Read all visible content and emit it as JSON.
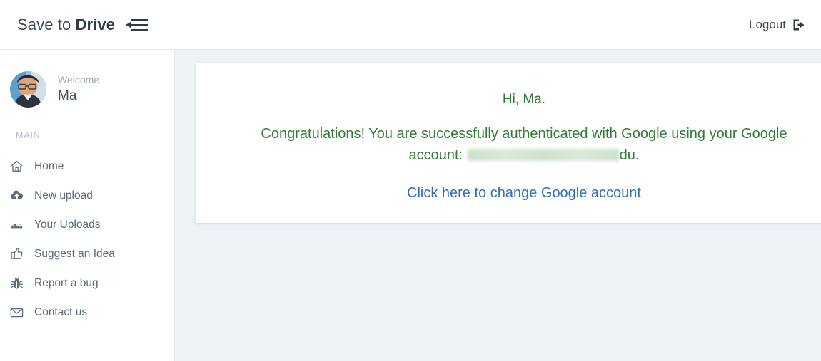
{
  "header": {
    "brand_prefix": "Save to ",
    "brand_strong": "Drive",
    "collapse_icon": "collapse-sidebar-icon",
    "logout_label": "Logout",
    "logout_icon": "sign-out-icon"
  },
  "sidebar": {
    "welcome_label": "Welcome",
    "username": "Ma",
    "avatar_icon": "user-avatar-photo",
    "section_label": "MAIN",
    "items": [
      {
        "label": "Home",
        "icon": "home-icon"
      },
      {
        "label": "New upload",
        "icon": "cloud-upload-icon"
      },
      {
        "label": "Your Uploads",
        "icon": "dashboard-icon"
      },
      {
        "label": "Suggest an Idea",
        "icon": "thumbs-up-icon"
      },
      {
        "label": "Report a bug",
        "icon": "bug-icon"
      },
      {
        "label": "Contact us",
        "icon": "envelope-icon"
      }
    ]
  },
  "main": {
    "greeting": "Hi, Ma.",
    "congrats_prefix": "Congratulations! You are successfully authenticated with Google using your Google account: ",
    "account_redacted": "",
    "congrats_suffix": "du.",
    "change_account_link": "Click here to change Google account"
  },
  "colors": {
    "accent_green": "#2e7d32",
    "link_blue": "#2f6fb5",
    "content_bg": "#ecf2f6",
    "sidebar_text": "#5a6a7a"
  }
}
